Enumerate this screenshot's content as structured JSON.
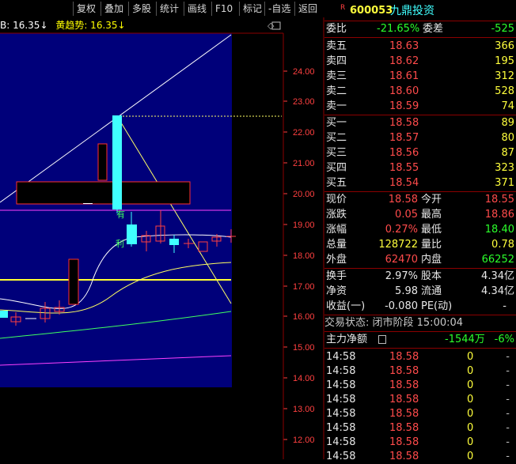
{
  "toolbar": {
    "items": [
      "复权",
      "叠加",
      "多股",
      "统计",
      "画线",
      "F10",
      "标记",
      "-自选",
      "返回"
    ]
  },
  "indicator_bar": {
    "b_label": "B: 16.35↓",
    "yellow_label": "黄趋势: 16.35↓"
  },
  "chart": {
    "y_axis": [
      "24.00",
      "23.00",
      "22.00",
      "21.00",
      "20.00",
      "19.00",
      "18.00",
      "17.00",
      "16.00",
      "15.00",
      "14.00",
      "13.00",
      "12.00"
    ],
    "labels": {
      "you": "有",
      "li": "利"
    }
  },
  "quote": {
    "code": "600053",
    "name": "九鼎投资",
    "ratio_label": "委比",
    "ratio_value": "-21.65%",
    "diff_label": "委差",
    "diff_value": "-525",
    "asks": [
      {
        "label": "卖五",
        "price": "18.63",
        "vol": "366"
      },
      {
        "label": "卖四",
        "price": "18.62",
        "vol": "195"
      },
      {
        "label": "卖三",
        "price": "18.61",
        "vol": "312"
      },
      {
        "label": "卖二",
        "price": "18.60",
        "vol": "528"
      },
      {
        "label": "卖一",
        "price": "18.59",
        "vol": "74"
      }
    ],
    "bids": [
      {
        "label": "买一",
        "price": "18.58",
        "vol": "89"
      },
      {
        "label": "买二",
        "price": "18.57",
        "vol": "80"
      },
      {
        "label": "买三",
        "price": "18.56",
        "vol": "87"
      },
      {
        "label": "买四",
        "price": "18.55",
        "vol": "323"
      },
      {
        "label": "买五",
        "price": "18.54",
        "vol": "371"
      }
    ],
    "stats": [
      {
        "l1": "现价",
        "v1": "18.58",
        "l2": "今开",
        "v2": "18.55"
      },
      {
        "l1": "涨跌",
        "v1": "0.05",
        "l2": "最高",
        "v2": "18.86"
      },
      {
        "l1": "涨幅",
        "v1": "0.27%",
        "l2": "最低",
        "v2": "18.40"
      },
      {
        "l1": "总量",
        "v1": "128722",
        "l2": "量比",
        "v2": "0.78"
      },
      {
        "l1": "外盘",
        "v1": "62470",
        "l2": "内盘",
        "v2": "66252"
      }
    ],
    "stats2": [
      {
        "l1": "换手",
        "v1": "2.97%",
        "l2": "股本",
        "v2": "4.34亿"
      },
      {
        "l1": "净资",
        "v1": "5.98",
        "l2": "流通",
        "v2": "4.34亿"
      },
      {
        "l1": "收益(一)",
        "v1": "-0.080",
        "l2": "PE(动)",
        "v2": "-"
      }
    ],
    "trade_status": "交易状态: 闭市阶段 15:00:04",
    "net_flow_label": "主力净额",
    "net_flow_value": "-1544万",
    "net_flow_pct": "-6%",
    "ticks": [
      {
        "time": "14:58",
        "price": "18.58",
        "vol": "0",
        "dir": "-"
      },
      {
        "time": "14:58",
        "price": "18.58",
        "vol": "0",
        "dir": "-"
      },
      {
        "time": "14:58",
        "price": "18.58",
        "vol": "0",
        "dir": "-"
      },
      {
        "time": "14:58",
        "price": "18.58",
        "vol": "0",
        "dir": "-"
      },
      {
        "time": "14:58",
        "price": "18.58",
        "vol": "0",
        "dir": "-"
      },
      {
        "time": "14:58",
        "price": "18.58",
        "vol": "0",
        "dir": "-"
      },
      {
        "time": "14:58",
        "price": "18.58",
        "vol": "0",
        "dir": "-"
      },
      {
        "time": "14:58",
        "price": "18.58",
        "vol": "0",
        "dir": "-"
      }
    ]
  }
}
